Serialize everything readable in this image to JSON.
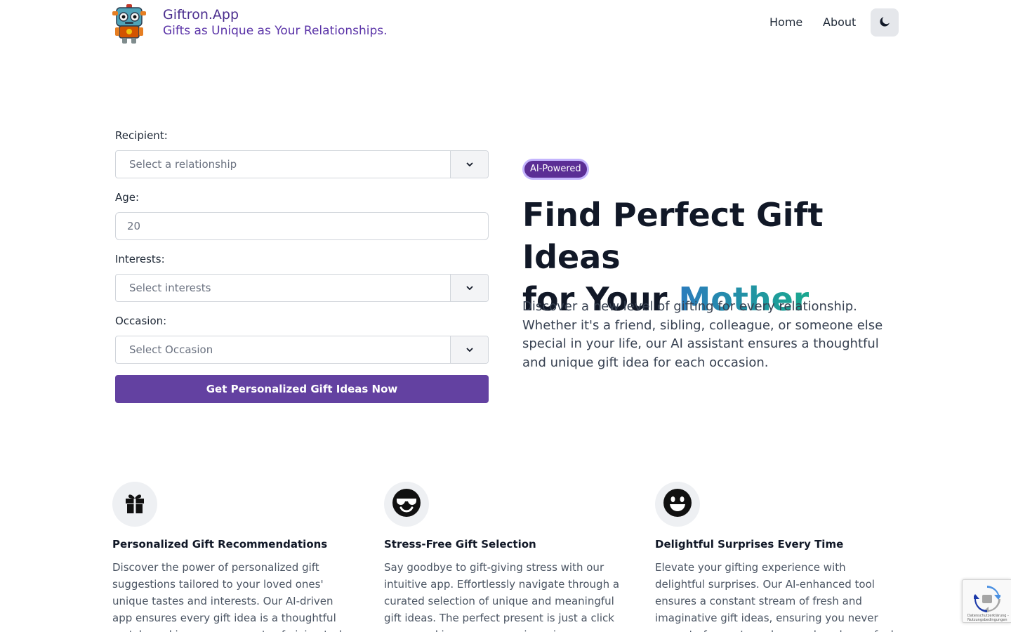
{
  "header": {
    "brand_title": "Giftron.App",
    "brand_tagline": "Gifts as Unique as Your Relationships.",
    "nav": {
      "home": "Home",
      "about": "About"
    }
  },
  "form": {
    "recipient": {
      "label": "Recipient:",
      "placeholder": "Select a relationship"
    },
    "age": {
      "label": "Age:",
      "value": "20"
    },
    "interests": {
      "label": "Interests:",
      "placeholder": "Select interests"
    },
    "occasion": {
      "label": "Occasion:",
      "placeholder": "Select Occasion"
    },
    "submit_label": "Get Personalized Gift Ideas Now"
  },
  "hero": {
    "badge": "AI-Powered",
    "title_line1": "Find Perfect Gift Ideas",
    "title_line2_prefix": "for Your ",
    "title_highlight": "Mother",
    "description": "Discover a new level of gifting for every relationship. Whether it's a friend, sibling, colleague, or someone else special in your life, our AI assistant ensures a thoughtful and unique gift idea for each occasion."
  },
  "features": [
    {
      "icon": "gift-icon",
      "title": "Personalized Gift Recommendations",
      "description": "Discover the power of personalized gift suggestions tailored to your loved ones' unique tastes and interests. Our AI-driven app ensures every gift idea is a thoughtful match, making your moments of giving truly special."
    },
    {
      "icon": "sunglasses-face-icon",
      "title": "Stress-Free Gift Selection",
      "description": "Say goodbye to gift-giving stress with our intuitive app. Effortlessly navigate through a curated selection of unique and meaningful gift ideas. The perfect present is just a click away, making every occasion a joyous celebration."
    },
    {
      "icon": "smile-face-icon",
      "title": "Delightful Surprises Every Time",
      "description": "Elevate your gifting experience with delightful surprises. Our AI-enhanced tool ensures a constant stream of fresh and imaginative gift ideas, ensuring you never run out of ways to make your loved ones feel special."
    }
  ],
  "recaptcha": {
    "privacy_text": "Datenschutzerklärung -",
    "terms_text": "Nutzungsbedingungen"
  },
  "colors": {
    "primary": "#6341a1",
    "brand_text": "#4c2f8f",
    "highlight_start": "#2b7bbd",
    "highlight_end": "#1aa88f"
  }
}
